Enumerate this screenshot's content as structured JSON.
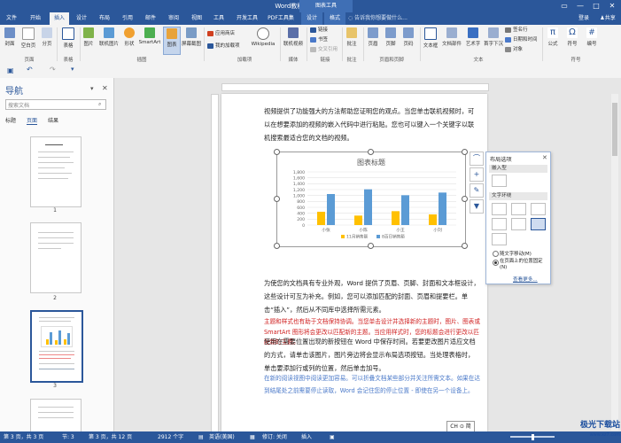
{
  "window": {
    "title": "Word教程2.docx - Word",
    "context_title": "图表工具"
  },
  "window_controls": {
    "restore": "▭",
    "minimize": "—",
    "maximize": "□",
    "close": "✕"
  },
  "tabs": [
    "文件",
    "开始",
    "插入",
    "设计",
    "布局",
    "引用",
    "邮件",
    "审阅",
    "视图",
    "工具",
    "开发工具",
    "PDF工具集",
    "设计",
    "格式"
  ],
  "tell_me": "告诉我你想要做什么...",
  "account": {
    "login": "登录",
    "share": "共享"
  },
  "ribbon": {
    "pages_buttons": [
      "封面",
      "空白页",
      "分页"
    ],
    "table": "表格",
    "illustrations": [
      "图片",
      "联机图片",
      "形状",
      "SmartArt",
      "图表",
      "屏幕截图"
    ],
    "addins": [
      "应用商店",
      "我的加载项",
      "Wikipedia"
    ],
    "media": "联机视频",
    "links": [
      "链接",
      "书签",
      "交叉引用"
    ],
    "comment": "批注",
    "header_footer": [
      "页眉",
      "页脚",
      "页码"
    ],
    "text": [
      "文本框",
      "文档部件",
      "艺术字",
      "首字下沉"
    ],
    "text_small": [
      "签名行",
      "日期和时间",
      "对象"
    ],
    "symbols": [
      "公式",
      "符号",
      "编号"
    ],
    "groups": [
      "页面",
      "表格",
      "插图",
      "加载项",
      "媒体",
      "链接",
      "批注",
      "页眉和页脚",
      "文本",
      "符号"
    ]
  },
  "nav": {
    "title": "导航",
    "search_placeholder": "搜索文档",
    "tabs": [
      "标题",
      "页面",
      "结果"
    ],
    "pages": [
      "1",
      "2",
      "3"
    ]
  },
  "document": {
    "p1": "视频提供了功能强大的方法帮助您证明您的观点。当您单击联机视频时，可以在想要添加的视频的嵌入代码中进行粘贴。您也可以键入一个关键字以联机搜索最适合您的文档的视频。",
    "p2": "为使您的文档具有专业外观，Word 提供了页眉、页脚、封面和文本框设计，这些设计可互为补充。例如，您可以添加匹配的封面、页眉和提要栏。单击“插入”，然后从不同库中选择所需元素。",
    "p3": "主题和样式也有助于文档保持协调。当您单击设计并选择新的主题时，图片、图表或 SmartArt 图形将会更改以匹配新的主题。当应用样式时，您的标题会进行更改以匹配新的主题。",
    "p4": "使用在需要位置出现的新按钮在 Word 中保存时间。若要更改图片适应文档的方式，请单击该图片，图片旁边将会显示布局选项按钮。当处理表格时，单击要添加行或列的位置，然后单击加号。",
    "p5": "在新的阅读视图中阅读更加容易。可以折叠文档某些部分并关注所需文本。如果在达到结尾处之前需要停止读取，Word 会记住您的停止位置 - 即使在另一个设备上。"
  },
  "chart_tools": {
    "layout": "⌒",
    "add": "+",
    "style": "✎",
    "filter": "▼"
  },
  "layout_panel": {
    "title": "布局选项",
    "inline_label": "嵌入型",
    "wrap_label": "文字环绕",
    "move_with_text": "随文字移动(M)",
    "fix_position": "在页面上的位置固定(N)",
    "see_more": "查看更多..."
  },
  "chart_data": {
    "type": "bar",
    "title": "图表标题",
    "categories": [
      "小张",
      "小陈",
      "小王",
      "小刘"
    ],
    "series": [
      {
        "name": "11月销售额",
        "values": [
          450,
          320,
          470,
          360
        ],
        "color": "#ffc000"
      },
      {
        "name": "8百日销售额",
        "values": [
          1050,
          1210,
          1010,
          1100
        ],
        "color": "#5b9bd5"
      }
    ],
    "ylim": [
      0,
      1800
    ],
    "yticks": [
      "0",
      "200",
      "400",
      "600",
      "800",
      "1,000",
      "1,200",
      "1,400",
      "1,600",
      "1,800"
    ],
    "grid": true,
    "legend": "bottom"
  },
  "status": {
    "page": "第 3 页，共 3 页",
    "section": "节: 3",
    "pagepos": "第 3 页，共 12 页",
    "words": "2912 个字",
    "lang": "英语(美国)",
    "track": "修订: 关闭",
    "mode": "插入",
    "ime": "CH ⊙ 简",
    "zoom": "100%"
  },
  "watermark": {
    "brand": "极光下载站",
    "url": "www.xz7.com"
  },
  "colors": {
    "brand": "#2b579a",
    "bar1": "#ffc000",
    "bar2": "#5b9bd5",
    "red_text": "#d02020",
    "blue_text": "#4a79c9"
  }
}
